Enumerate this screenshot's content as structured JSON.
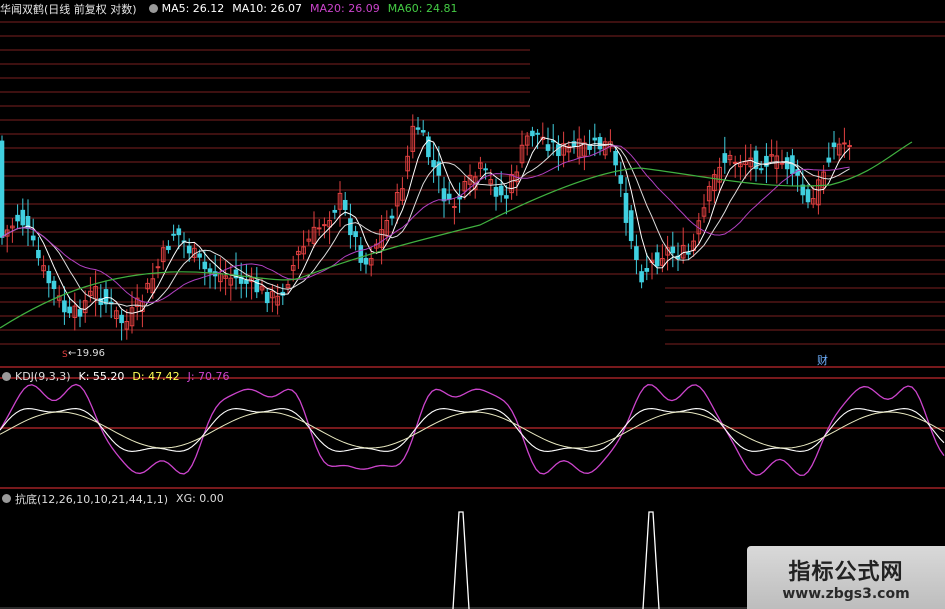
{
  "main_chart": {
    "title": "华闻双鹤(日线 前复权 对数)",
    "legend": [
      {
        "label": "MA5: 26.12",
        "color": "#ffffff"
      },
      {
        "label": "MA10: 26.07",
        "color": "#ffffff"
      },
      {
        "label": "MA20: 26.09",
        "color": "#cc44cc"
      },
      {
        "label": "MA60: 24.81",
        "color": "#44cc44"
      }
    ],
    "low_price_label": "19.96",
    "marker_s": "S",
    "marker_cai": "财"
  },
  "kdj": {
    "title": "KDJ(9,3,3)",
    "k": "K: 55.20",
    "d": "D: 47.42",
    "j": "J: 70.76",
    "k_color": "#ffffff",
    "d_color": "#ffff55",
    "j_color": "#cc44cc"
  },
  "xg": {
    "title": "抗底(12,26,10,10,21,44,1,1)",
    "value": "XG: 0.00"
  },
  "watermark": {
    "title": "指标公式网",
    "url": "www.zbgs3.com"
  },
  "colors": {
    "up": "#e04040",
    "down": "#40d0e0",
    "ma_white": "#ffffff",
    "ma20": "#b040c0",
    "ma60": "#40b040"
  }
}
